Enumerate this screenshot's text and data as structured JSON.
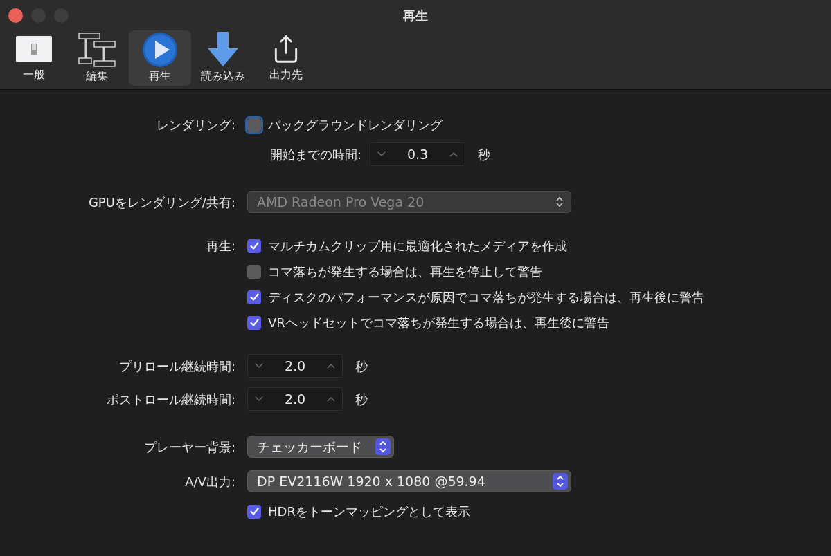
{
  "window": {
    "title": "再生"
  },
  "toolbar": [
    {
      "kind": "general",
      "label": "一般",
      "selected": false
    },
    {
      "kind": "edit",
      "label": "編集",
      "selected": false
    },
    {
      "kind": "playback",
      "label": "再生",
      "selected": true
    },
    {
      "kind": "import",
      "label": "読み込み",
      "selected": false
    },
    {
      "kind": "destination",
      "label": "出力先",
      "selected": false
    }
  ],
  "groups": [
    {
      "rows": [
        {
          "kind": "checkbox",
          "label": "レンダリング:",
          "text": "バックグラウンドレンダリング",
          "checked": false,
          "focused": true
        },
        {
          "kind": "inline_stepper",
          "text": "開始までの時間:",
          "value": "0.3",
          "unit": "秒"
        }
      ]
    },
    {
      "rows": [
        {
          "kind": "popup",
          "label": "GPUをレンダリング/共有:",
          "value": "AMD Radeon Pro Vega 20",
          "disabled": true,
          "wide": true
        }
      ]
    },
    {
      "rows": [
        {
          "kind": "checkbox",
          "label": "再生:",
          "text": "マルチカムクリップ用に最適化されたメディアを作成",
          "checked": true,
          "focused": false
        },
        {
          "kind": "checkbox",
          "text": "コマ落ちが発生する場合は、再生を停止して警告",
          "checked": false,
          "focused": false
        },
        {
          "kind": "checkbox",
          "text": "ディスクのパフォーマンスが原因でコマ落ちが発生する場合は、再生後に警告",
          "checked": true,
          "focused": false
        },
        {
          "kind": "checkbox",
          "text": "VRヘッドセットでコマ落ちが発生する場合は、再生後に警告",
          "checked": true,
          "focused": false
        }
      ]
    },
    {
      "rows": [
        {
          "kind": "stepper",
          "label": "プリロール継続時間:",
          "value": "2.0",
          "unit": "秒"
        },
        {
          "kind": "stepper",
          "label": "ポストロール継続時間:",
          "value": "2.0",
          "unit": "秒"
        }
      ]
    },
    {
      "rows": [
        {
          "kind": "popup",
          "label": "プレーヤー背景:",
          "value": "チェッカーボード",
          "disabled": false,
          "wide": false
        },
        {
          "kind": "popup",
          "label": "A/V出力:",
          "value": "DP EV2116W 1920 x 1080 @59.94",
          "disabled": false,
          "wide": true
        },
        {
          "kind": "checkbox",
          "text": "HDRをトーンマッピングとして表示",
          "checked": true,
          "focused": false
        }
      ]
    }
  ]
}
